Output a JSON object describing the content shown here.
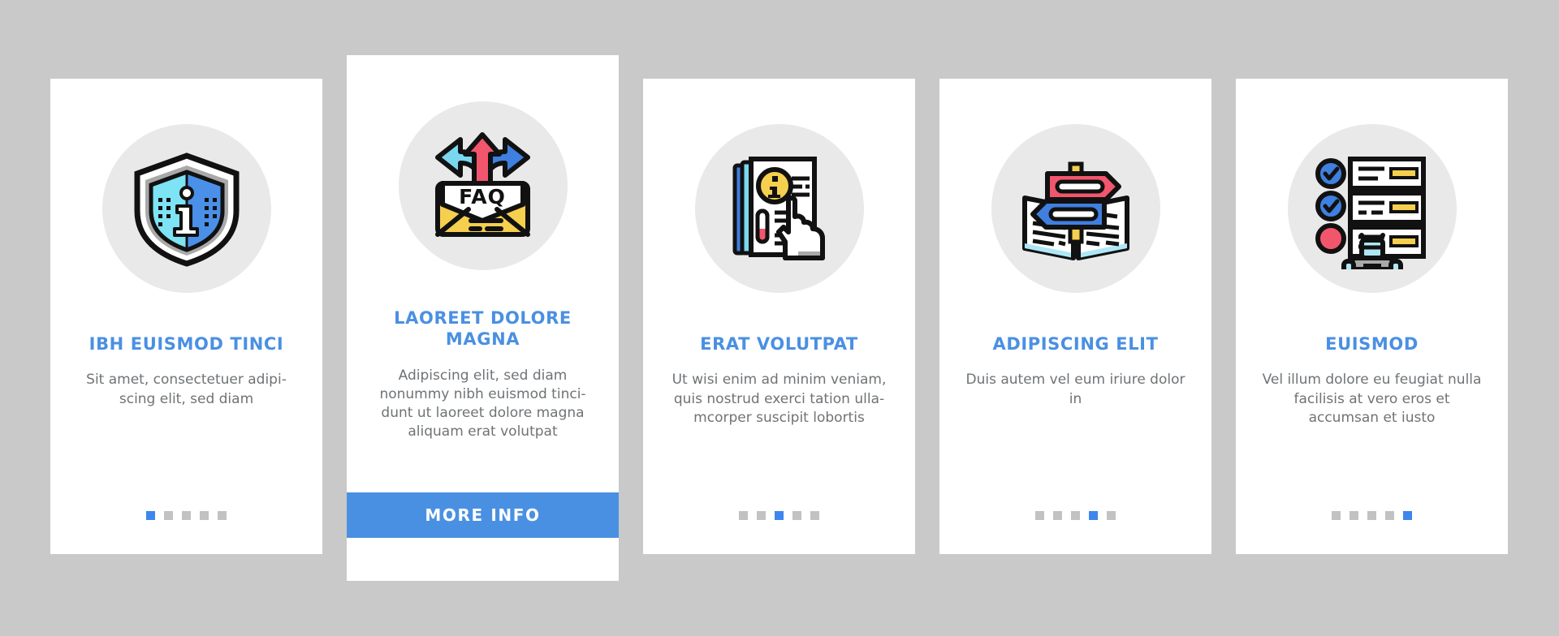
{
  "page": {
    "background_color": "#c9c9c9",
    "accent_color": "#4a90e2",
    "card_background": "#ffffff",
    "icon_circle_color": "#e9e9e9",
    "title_color": "#4a90e2",
    "body_color": "#6f7376",
    "dot_inactive_color": "#c2c2c2",
    "dot_active_color": "#3d86ee"
  },
  "cards": [
    {
      "id": "card-1",
      "featured": false,
      "icon_name": "info-shield-icon",
      "title": "IBH EUISMOD TINCI",
      "body": "Sit amet, consectetuer adipi-scing elit, sed diam",
      "dots": {
        "count": 5,
        "active_index": 0
      },
      "button": null
    },
    {
      "id": "card-2",
      "featured": true,
      "icon_name": "faq-envelope-icon",
      "title": "LAOREET DOLORE MAGNA",
      "body": "Adipiscing elit, sed diam nonummy nibh euismod tinci-dunt ut laoreet dolore magna aliquam erat volutpat",
      "dots": null,
      "button": {
        "label": "MORE INFO"
      }
    },
    {
      "id": "card-3",
      "featured": false,
      "icon_name": "info-document-hand-icon",
      "title": "ERAT VOLUTPAT",
      "body": "Ut wisi enim ad minim veniam, quis nostrud exerci tation ulla-mcorper suscipit lobortis",
      "dots": {
        "count": 5,
        "active_index": 2
      },
      "button": null
    },
    {
      "id": "card-4",
      "featured": false,
      "icon_name": "signpost-book-icon",
      "title": "ADIPISCING ELIT",
      "body": "Duis autem vel eum iriure dolor in",
      "dots": {
        "count": 5,
        "active_index": 3
      },
      "button": null
    },
    {
      "id": "card-5",
      "featured": false,
      "icon_name": "checklist-robot-icon",
      "title": "EUISMOD",
      "body": "Vel illum dolore eu feugiat nulla facilisis at vero eros et accumsan et iusto",
      "dots": {
        "count": 5,
        "active_index": 4
      },
      "button": null
    }
  ]
}
